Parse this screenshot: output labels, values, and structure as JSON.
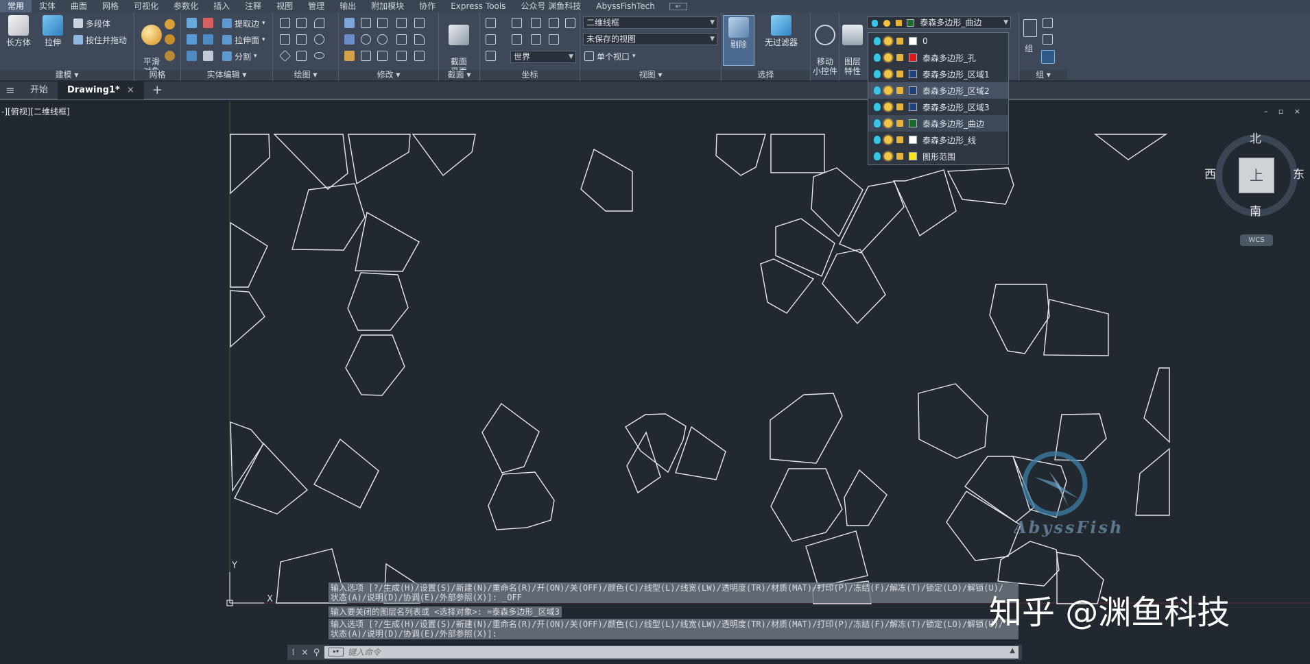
{
  "menubar": {
    "items": [
      "常用",
      "实体",
      "曲面",
      "网格",
      "可视化",
      "参数化",
      "插入",
      "注释",
      "视图",
      "管理",
      "输出",
      "附加模块",
      "协作",
      "Express Tools",
      "公众号 渊鱼科技",
      "AbyssFishTech"
    ]
  },
  "ribbon": {
    "panels": {
      "modeling": {
        "title": "建模 ▾",
        "box": "长方体",
        "extrude": "拉伸",
        "polysolid": "多段体",
        "presspull": "按住并拖动"
      },
      "mesh": {
        "title": "网格",
        "smooth": "平滑\n对象"
      },
      "solid_edit": {
        "title": "实体编辑 ▾",
        "extract": "提取边",
        "extrude_face": "拉伸面",
        "separate": "分割"
      },
      "draw": {
        "title": "绘图 ▾"
      },
      "modify": {
        "title": "修改 ▾"
      },
      "section": {
        "title": "截面 ▾",
        "plane": "截面\n平面"
      },
      "coordinates": {
        "title": "坐标",
        "world": "世界"
      },
      "view": {
        "title": "视图 ▾",
        "visual_style": "二维线框",
        "saved_view": "未保存的视图",
        "viewport": "单个视口"
      },
      "selection": {
        "title": "选择",
        "cull": "剔除",
        "no_filter": "无过滤器"
      },
      "gizmo": {
        "move": "移动\n小控件"
      },
      "layers": {
        "props": "图层\n特性",
        "current": "泰森多边形_曲边"
      },
      "groups": {
        "title": "组 ▾",
        "group": "组"
      }
    }
  },
  "tabs": {
    "start": "开始",
    "drawing": "Drawing1*",
    "close": "×",
    "new": "+"
  },
  "viewport": {
    "label": "-][俯视][二维线框]",
    "controls": "– ▫ ×",
    "compass": {
      "north": "北",
      "south": "南",
      "east": "东",
      "west": "西",
      "face": "上"
    },
    "wcs": "WCS",
    "ucs_x": "X",
    "ucs_y": "Y"
  },
  "layer_dropdown": {
    "layers": [
      {
        "name": "0",
        "color": "#ffffff"
      },
      {
        "name": "泰森多边形_孔",
        "color": "#e01818"
      },
      {
        "name": "泰森多边形_区域1",
        "color": "#1f3f7a"
      },
      {
        "name": "泰森多边形_区域2",
        "color": "#1f3f7a"
      },
      {
        "name": "泰森多边形_区域3",
        "color": "#1f3f7a"
      },
      {
        "name": "泰森多边形_曲边",
        "color": "#1a6b2a"
      },
      {
        "name": "泰森多边形_线",
        "color": "#ffffff"
      },
      {
        "name": "图形范围",
        "color": "#f5e51a"
      }
    ],
    "highlighted_index": 3,
    "selected_index": 5
  },
  "command": {
    "history": [
      "输入选项 [?/生成(H)/设置(S)/新建(N)/重命名(R)/开(ON)/关(OFF)/颜色(C)/线型(L)/线宽(LW)/透明度(TR)/材质(MAT)/打印(P)/冻结(F)/解冻(T)/锁定(LO)/解锁(U)/\n状态(A)/说明(D)/协调(E)/外部参照(X)]: _OFF",
      "输入要关闭的图层名列表或 <选择对象>: =泰森多边形_区域3",
      "输入选项 [?/生成(H)/设置(S)/新建(N)/重命名(R)/开(ON)/关(OFF)/颜色(C)/线型(L)/线宽(LW)/透明度(TR)/材质(MAT)/打印(P)/冻结(F)/解冻(T)/锁定(LO)/解锁(U)/\n状态(A)/说明(D)/协调(E)/外部参照(X)]:"
    ],
    "placeholder": "键入命令"
  },
  "watermark": {
    "zh": "知乎 @渊鱼科技",
    "fish": "AbyssFish"
  },
  "colors": {
    "line": "#e6e9ec",
    "background": "#212830",
    "ribbon": "#3f4858"
  }
}
